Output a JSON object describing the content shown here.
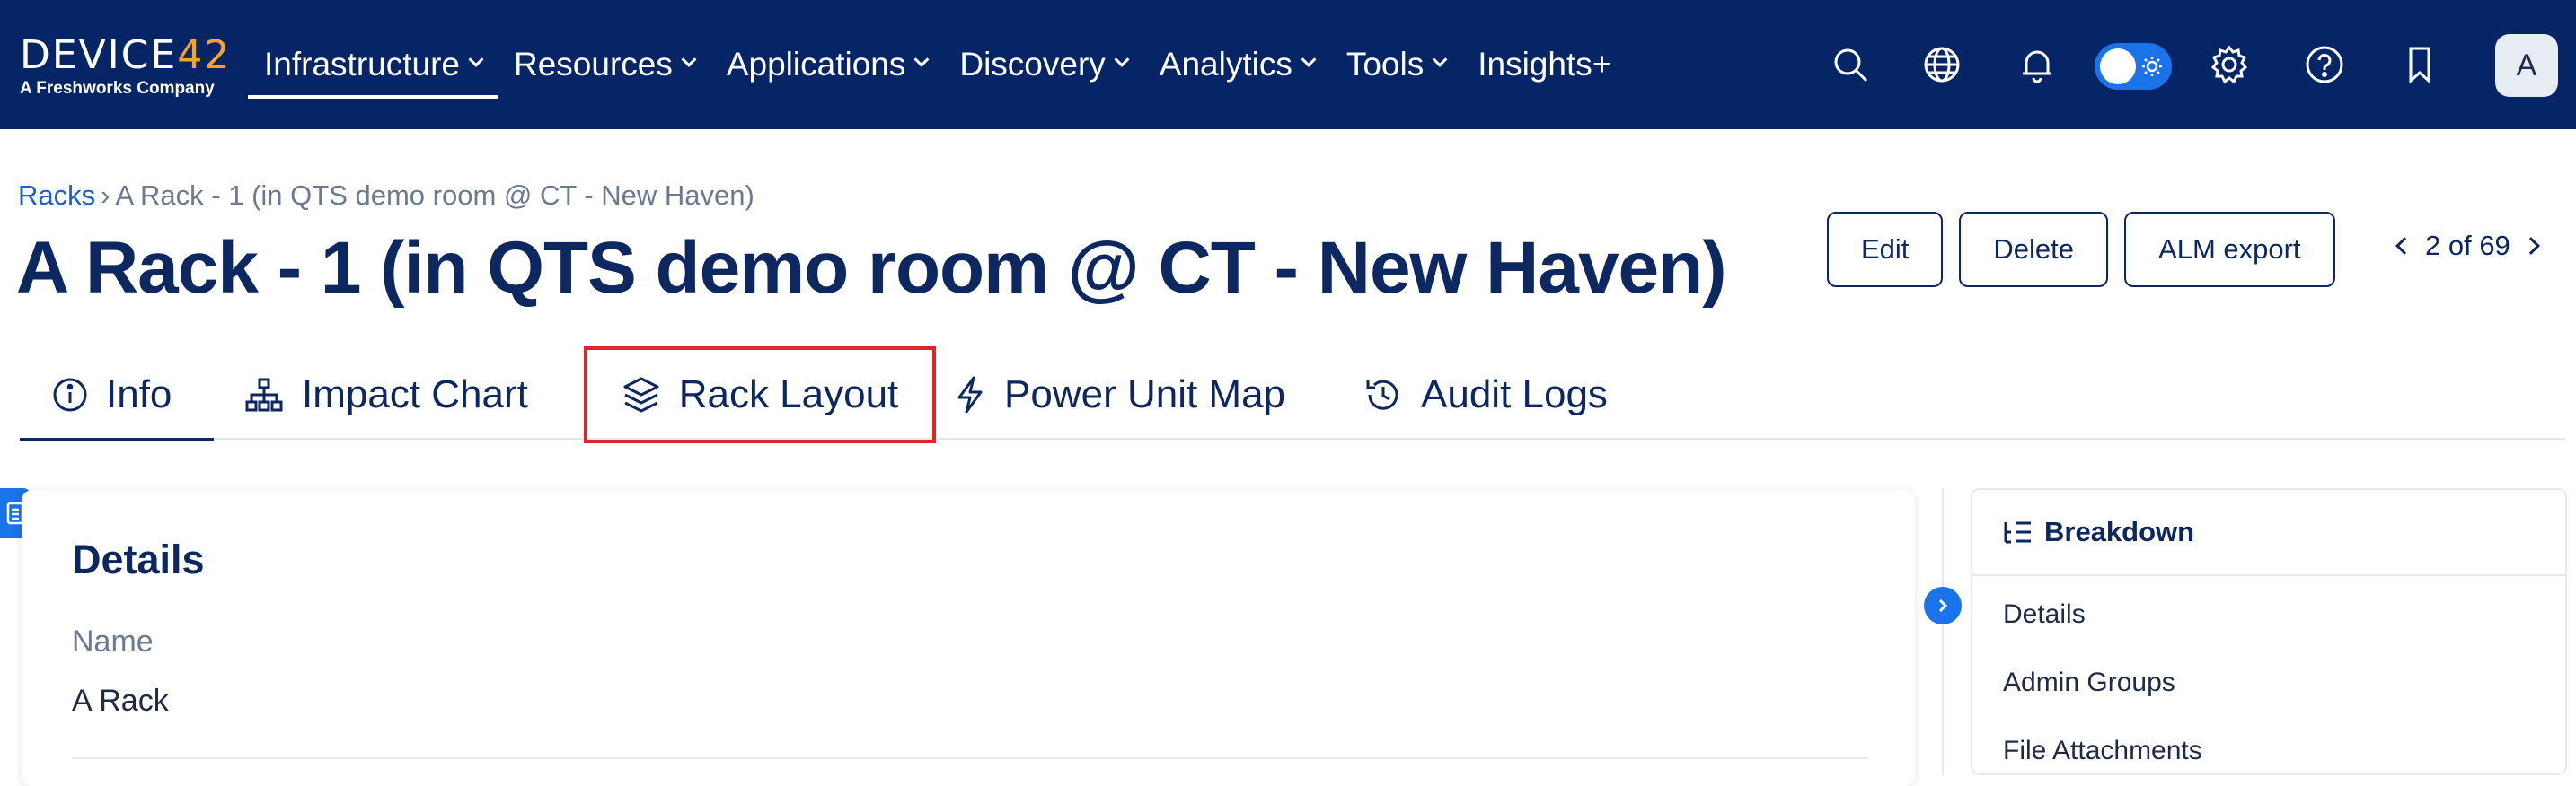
{
  "brand": {
    "logo_main": "DEVICE",
    "logo_accent": "42",
    "logo_sub": "A Freshworks Company"
  },
  "nav": {
    "items": [
      {
        "label": "Infrastructure",
        "has_dropdown": true,
        "active": true
      },
      {
        "label": "Resources",
        "has_dropdown": true
      },
      {
        "label": "Applications",
        "has_dropdown": true
      },
      {
        "label": "Discovery",
        "has_dropdown": true
      },
      {
        "label": "Analytics",
        "has_dropdown": true
      },
      {
        "label": "Tools",
        "has_dropdown": true
      },
      {
        "label": "Insights+",
        "has_dropdown": false
      }
    ],
    "icons": [
      "search-icon",
      "globe-icon",
      "bell-icon",
      "theme-toggle",
      "gear-icon",
      "help-icon",
      "bookmark-icon"
    ],
    "avatar_initial": "A"
  },
  "breadcrumb": {
    "parent": "Racks",
    "separator": "›",
    "current": "A Rack - 1 (in QTS demo room @ CT - New Haven)"
  },
  "page": {
    "title": "A Rack - 1 (in QTS demo room @ CT - New Haven)"
  },
  "actions": {
    "edit": "Edit",
    "delete": "Delete",
    "alm_export": "ALM export",
    "pager": "2 of 69"
  },
  "tabs": [
    {
      "label": "Info",
      "icon": "info-icon",
      "active": true
    },
    {
      "label": "Impact Chart",
      "icon": "hierarchy-icon"
    },
    {
      "label": "Rack Layout",
      "icon": "layers-icon",
      "highlighted": true
    },
    {
      "label": "Power Unit Map",
      "icon": "bolt-icon"
    },
    {
      "label": "Audit Logs",
      "icon": "history-icon"
    }
  ],
  "details": {
    "title": "Details",
    "name_label": "Name",
    "name_value": "A Rack"
  },
  "breakdown": {
    "title": "Breakdown",
    "items": [
      "Details",
      "Admin Groups",
      "File Attachments"
    ]
  },
  "colors": {
    "topbar": "#062566",
    "accent": "#1a73e8",
    "logo_accent": "#f4a32c",
    "highlight": "#e0242b",
    "heading": "#0d2761"
  }
}
